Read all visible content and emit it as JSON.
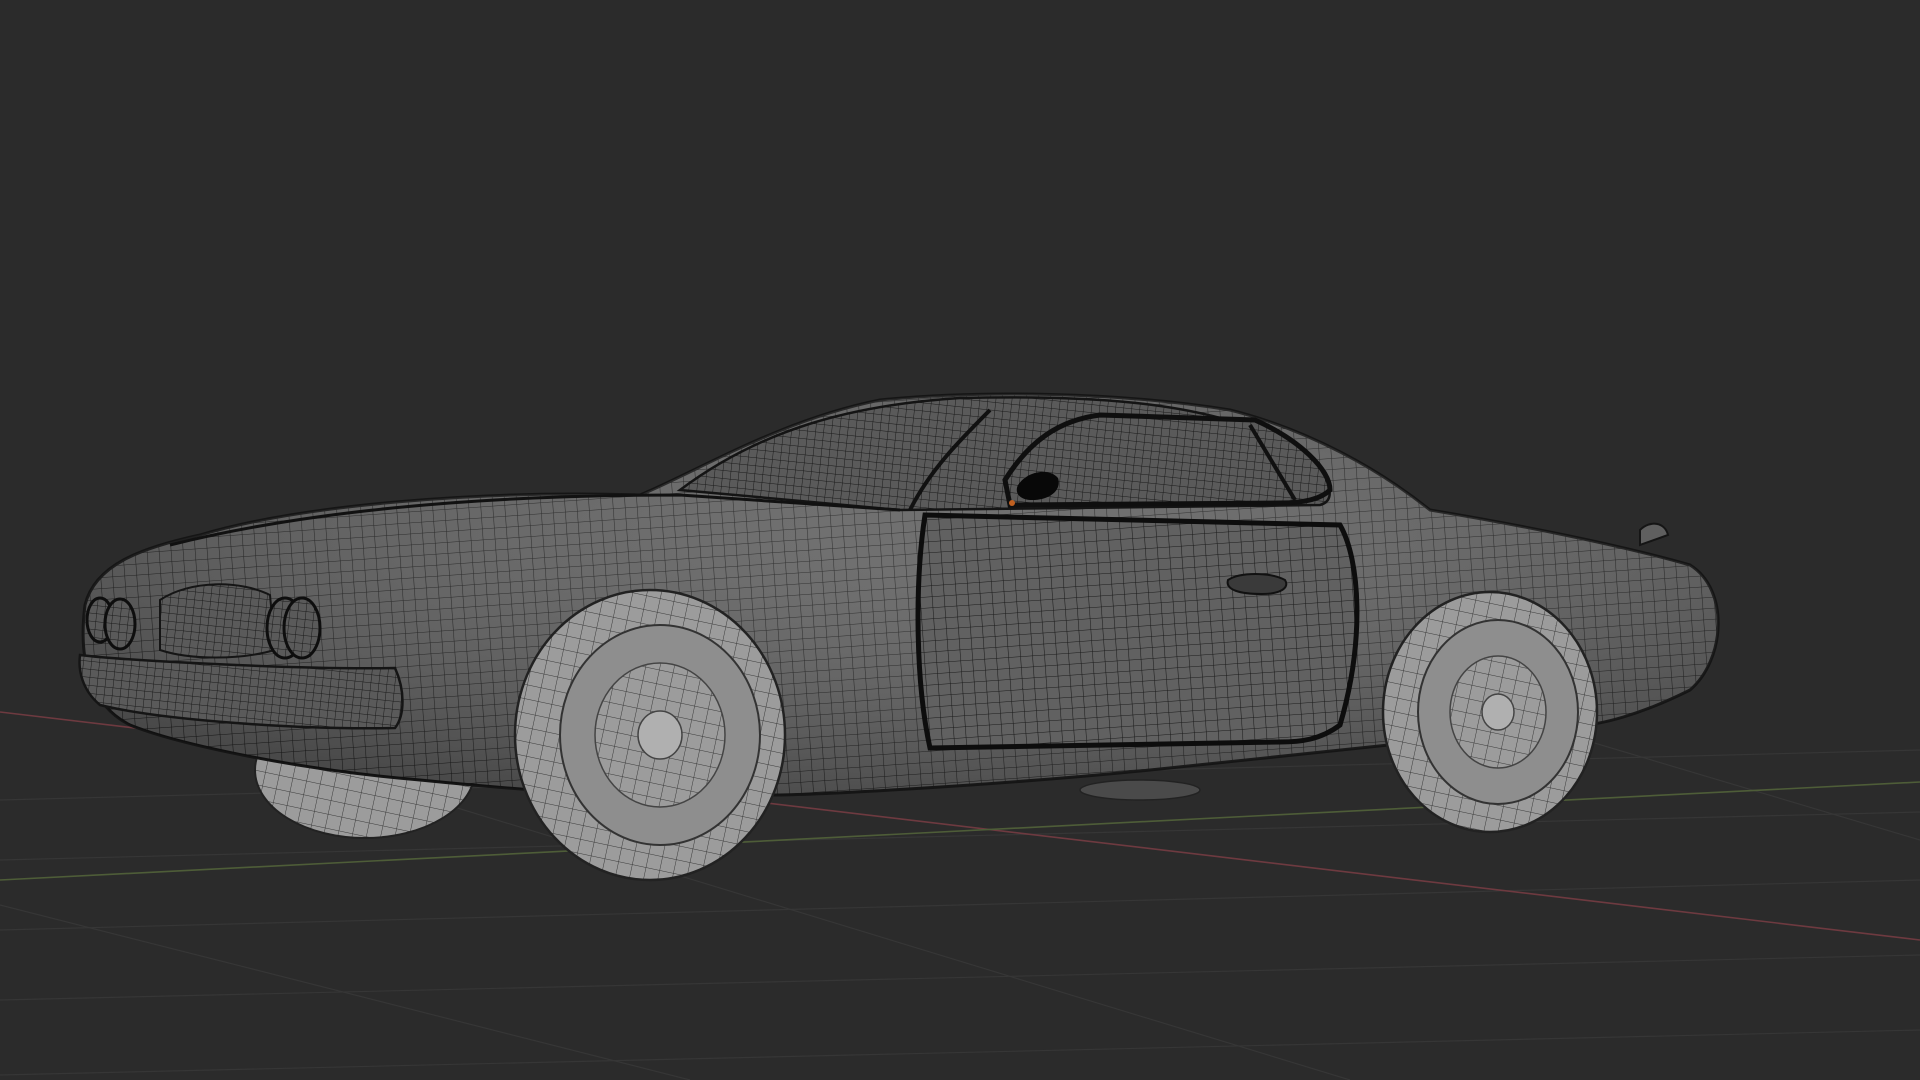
{
  "viewport": {
    "background_color": "#2b2b2b",
    "grid_color": "#383838",
    "x_axis_color": "#7a3a40",
    "y_axis_color": "#55663a",
    "mesh_fill_color": "#5f5f5f",
    "mesh_wire_color": "#1a1a1a",
    "tire_color": "#9a9a9a",
    "object": "car-mesh"
  }
}
